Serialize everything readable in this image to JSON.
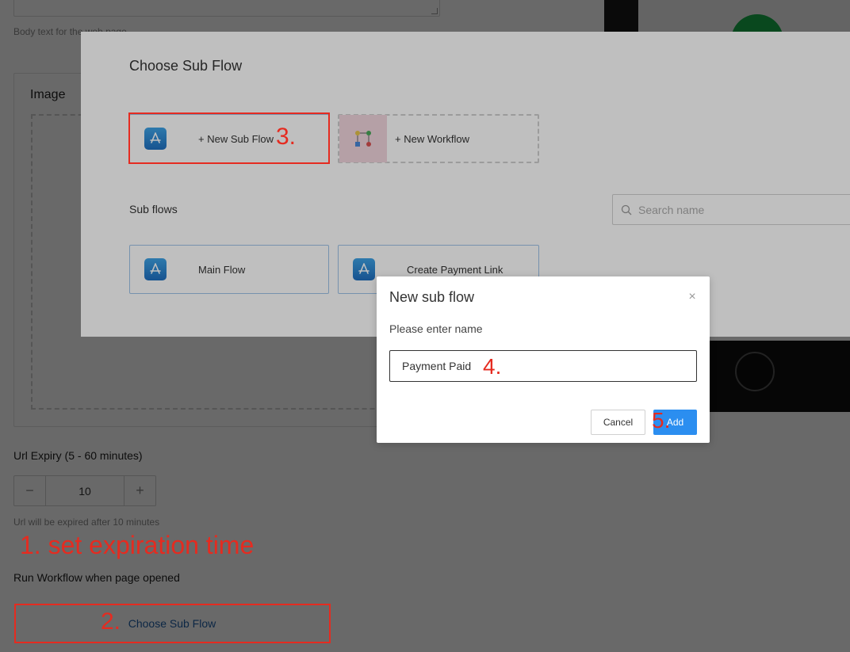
{
  "base": {
    "body_hint": "Body text for the web page",
    "image_title": "Image",
    "url_expiry_label": "Url Expiry (5 - 60 minutes)",
    "stepper_minus": "−",
    "stepper_value": "10",
    "stepper_plus": "+",
    "expiry_hint": "Url will be expired after 10 minutes",
    "run_workflow_label": "Run Workflow when page opened",
    "choose_subflow_button": "Choose Sub Flow"
  },
  "drawer": {
    "title": "Choose Sub Flow",
    "new_subflow_label": "+ New Sub Flow",
    "new_workflow_label": "+ New Workflow",
    "subflows_label": "Sub flows",
    "search_placeholder": "Search name",
    "subflows": [
      {
        "label": "Main Flow"
      },
      {
        "label": "Create Payment Link"
      }
    ]
  },
  "modal": {
    "title": "New sub flow",
    "close_glyph": "×",
    "prompt": "Please enter name",
    "name_value": "Payment Paid",
    "cancel_label": "Cancel",
    "add_label": "Add"
  },
  "annotations": {
    "step1": "1. set expiration time",
    "step2": "2.",
    "step3": "3.",
    "step4": "4.",
    "step5": "5."
  },
  "colors": {
    "annotation": "#e52b20",
    "primary": "#2b8ef0",
    "link": "#1f5fa8"
  }
}
